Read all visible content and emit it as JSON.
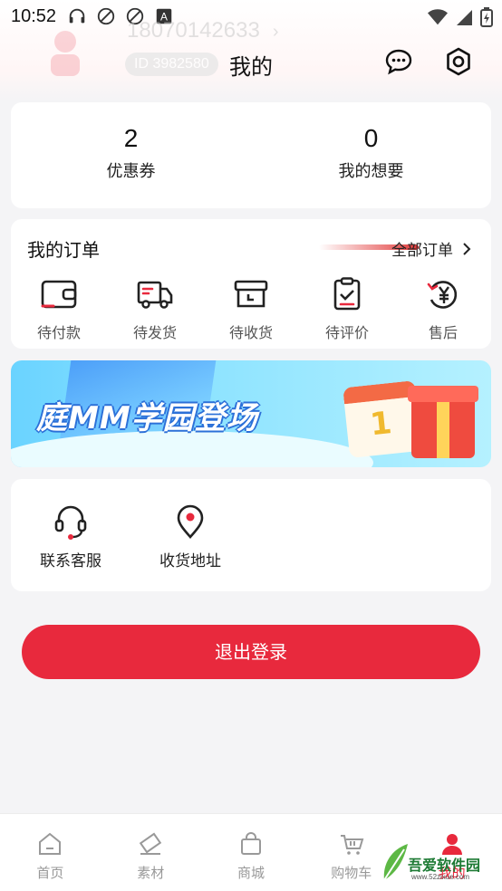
{
  "status_bar": {
    "time": "10:52"
  },
  "profile": {
    "phone": "18070142633",
    "id_label": "ID 3982580"
  },
  "header": {
    "title": "我的"
  },
  "stats": [
    {
      "value": "2",
      "label": "优惠券"
    },
    {
      "value": "0",
      "label": "我的想要"
    }
  ],
  "orders": {
    "title": "我的订单",
    "all_label": "全部订单",
    "items": [
      {
        "label": "待付款",
        "icon": "wallet-icon"
      },
      {
        "label": "待发货",
        "icon": "truck-icon"
      },
      {
        "label": "待收货",
        "icon": "box-icon"
      },
      {
        "label": "待评价",
        "icon": "clipboard-check-icon"
      },
      {
        "label": "售后",
        "icon": "refund-yen-icon"
      }
    ]
  },
  "banner": {
    "text": "庭MM学园登场",
    "calendar_number": "1"
  },
  "services": [
    {
      "label": "联系客服",
      "icon": "headset-icon"
    },
    {
      "label": "收货地址",
      "icon": "location-pin-icon"
    }
  ],
  "logout": {
    "label": "退出登录"
  },
  "tabs": [
    {
      "label": "首页",
      "icon": "home-icon"
    },
    {
      "label": "素材",
      "icon": "material-icon"
    },
    {
      "label": "商城",
      "icon": "shopping-bag-icon"
    },
    {
      "label": "购物车",
      "icon": "cart-icon"
    },
    {
      "label": "我的",
      "icon": "user-icon"
    }
  ],
  "watermark": {
    "text": "吾爱软件园",
    "url": "www.52zixue.com"
  },
  "colors": {
    "accent": "#e8293d",
    "background": "#f4f4f6"
  }
}
